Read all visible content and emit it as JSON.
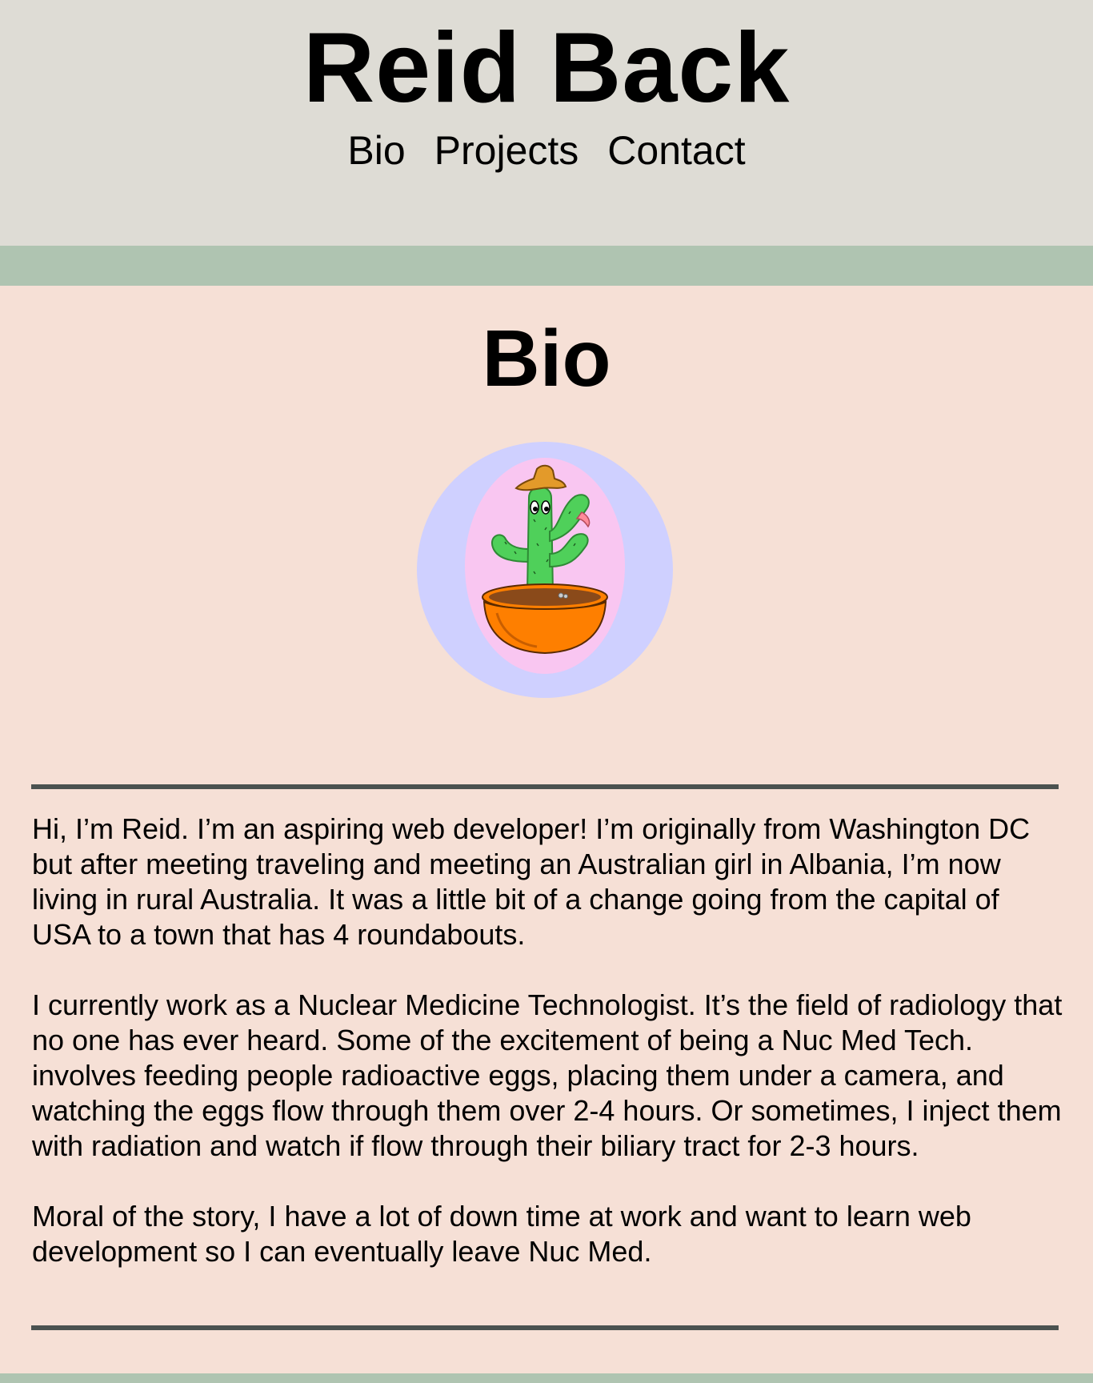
{
  "header": {
    "title": "Reid Back",
    "nav": [
      "Bio",
      "Projects",
      "Contact"
    ]
  },
  "bio": {
    "heading": "Bio",
    "image_alt": "Cartoon cactus wearing a cowboy hat in an orange pot",
    "paragraphs": [
      "Hi, I’m Reid. I’m an aspiring web developer! I’m originally from Washington DC but after meeting traveling and meeting an Australian girl in Albania, I’m now living in rural Australia. It was a little bit of a change going from the capital of USA to a town that has 4 roundabouts.",
      "I currently work as a Nuclear Medicine Technologist. It’s the field of radiology that no one has ever heard. Some of the excitement of being a Nuc Med Tech. involves feeding people radioactive eggs, placing them under a camera, and watching the eggs flow through them over 2-4 hours. Or sometimes, I inject them with radiation and watch if flow through their biliary tract for 2-3 hours.",
      "Moral of the story, I have a lot of down time at work and want to learn web development so I can eventually leave Nuc Med."
    ]
  },
  "colors": {
    "header_bg": "#dedcd5",
    "band": "#afc4b1",
    "page_bg": "#f6e0d6",
    "rule": "#4b5250",
    "portrait_outer": "#cfd0ff",
    "portrait_inner": "#f9c6f1",
    "cactus": "#4fd05a",
    "pot": "#fe7f00"
  }
}
